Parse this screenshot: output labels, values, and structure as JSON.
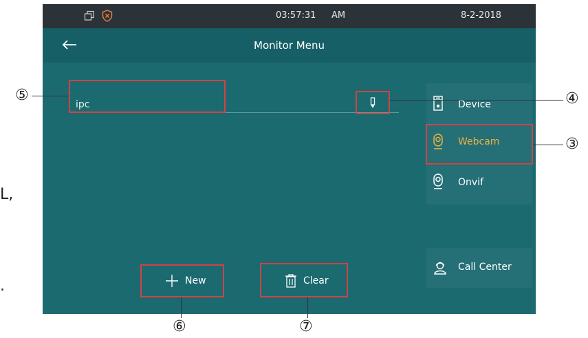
{
  "status_bar": {
    "time": "03:57:31",
    "ampm": "AM",
    "date": "8-2-2018"
  },
  "header": {
    "title": "Monitor Menu",
    "back_icon": "arrow-left-icon"
  },
  "entry": {
    "name": "ipc"
  },
  "sidebar": {
    "items": [
      {
        "label": "Device",
        "icon": "device-icon",
        "active": false
      },
      {
        "label": "Webcam",
        "icon": "webcam-icon",
        "active": true
      },
      {
        "label": "Onvif",
        "icon": "webcam-icon",
        "active": false
      }
    ],
    "call_center": {
      "label": "Call Center",
      "icon": "agent-icon"
    }
  },
  "buttons": {
    "new_label": "New",
    "clear_label": "Clear"
  },
  "callouts": {
    "c3": "③",
    "c4": "④",
    "c5": "⑤",
    "c6": "⑥",
    "c7": "⑦"
  },
  "side_text": {
    "line1": "L,",
    "line2": "."
  },
  "colors": {
    "accent": "#f1b23e",
    "annotation": "#d24343",
    "background": "#1b6a70"
  }
}
